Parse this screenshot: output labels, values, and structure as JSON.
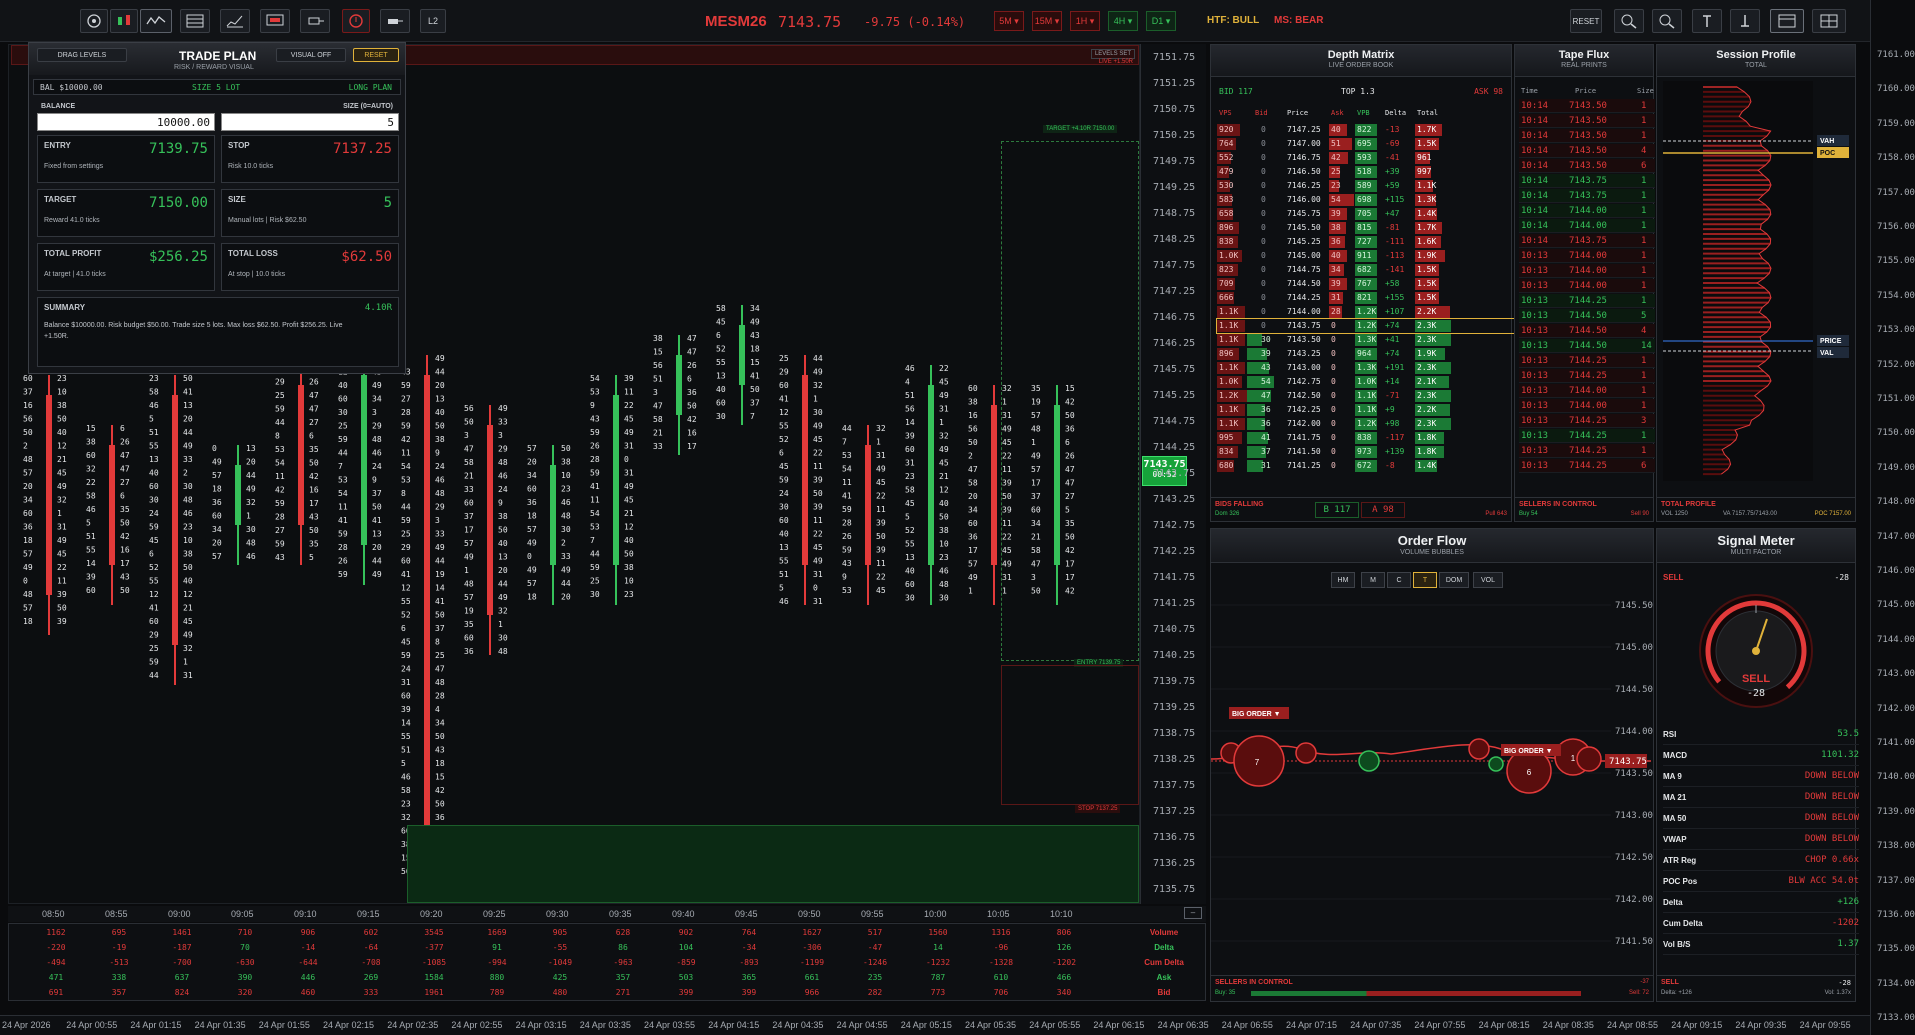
{
  "toolbar": {
    "symbol": "MESM26",
    "price": "7143.75",
    "change": "-9.75 (-0.14%)",
    "l2_label": "L2",
    "timeframes": [
      {
        "label": "5M",
        "state": "red"
      },
      {
        "label": "15M",
        "state": "red"
      },
      {
        "label": "1H",
        "state": "red"
      },
      {
        "label": "4H",
        "state": "green"
      },
      {
        "label": "D1",
        "state": "green"
      }
    ],
    "htf": "HTF: BULL",
    "ms": "MS: BEAR",
    "reset_label": "RESET",
    "tool_icons": [
      "target-icon",
      "candles-icon",
      "wave-icon",
      "table-icon",
      "line-chart-icon",
      "monitor-icon",
      "level-icon",
      "alert-icon",
      "marker-icon"
    ],
    "right_icons": [
      "zoom-in-icon",
      "zoom-out-icon",
      "line-up-icon",
      "line-down-icon",
      "layout-icon",
      "grid-icon"
    ]
  },
  "trade_plan": {
    "drag_levels": "DRAG LEVELS",
    "title": "TRADE PLAN",
    "subtitle": "RISK / REWARD VISUAL",
    "visual_off": "VISUAL OFF",
    "reset": "RESET",
    "bal": "BAL $10000.00",
    "size_lot": "SIZE 5 LOT",
    "long_plan": "LONG PLAN",
    "balance_label": "BALANCE",
    "balance_value": "10000.00",
    "size_label": "SIZE (0=AUTO)",
    "size_value": "5",
    "entry_label": "ENTRY",
    "entry_value": "7139.75",
    "entry_sub": "Fixed from settings",
    "stop_label": "STOP",
    "stop_value": "7137.25",
    "stop_sub": "Risk 10.0 ticks",
    "target_label": "TARGET",
    "target_value": "7150.00",
    "target_sub": "Reward 41.0 ticks",
    "size_box_label": "SIZE",
    "size_box_value": "5",
    "size_box_sub": "Manual lots | Risk $62.50",
    "profit_label": "TOTAL PROFIT",
    "profit_value": "$256.25",
    "profit_sub": "At target | 41.0 ticks",
    "loss_label": "TOTAL LOSS",
    "loss_value": "$62.50",
    "loss_sub": "At stop | 10.0 ticks",
    "summary_label": "SUMMARY",
    "summary_r": "4.10R",
    "summary_text": "Balance $10000.00. Risk budget $50.00. Trade size 5 lots. Max loss $62.50. Profit $256.25. Live +1.50R."
  },
  "chart_overlay": {
    "levels_set": "LEVELS SET",
    "live": "LIVE +1.50R",
    "target_tag": "TARGET +4.10R  7150.00",
    "entry_tag": "ENTRY  7139.75",
    "stop_tag": "STOP  7137.25",
    "current_price": "7143.75",
    "countdown": "00:52"
  },
  "price_axis": [
    "7151.75",
    "7151.25",
    "7150.75",
    "7150.25",
    "7149.75",
    "7149.25",
    "7148.75",
    "7148.25",
    "7147.75",
    "7147.25",
    "7146.75",
    "7146.25",
    "7145.75",
    "7145.25",
    "7144.75",
    "7144.25",
    "7143.75",
    "7143.25",
    "7142.75",
    "7142.25",
    "7141.75",
    "7141.25",
    "7140.75",
    "7140.25",
    "7139.75",
    "7139.25",
    "7138.75",
    "7138.25",
    "7137.75",
    "7137.25",
    "7136.75",
    "7136.25",
    "7135.75"
  ],
  "time_axis": [
    "08:50",
    "08:55",
    "09:00",
    "09:05",
    "09:10",
    "09:15",
    "09:20",
    "09:25",
    "09:30",
    "09:35",
    "09:40",
    "09:45",
    "09:50",
    "09:55",
    "10:00",
    "10:05",
    "10:10"
  ],
  "bottom_table": {
    "labels": [
      "Volume",
      "Delta",
      "Cum Delta",
      "Ask",
      "Bid"
    ],
    "rows": [
      [
        "1162",
        "695",
        "1461",
        "710",
        "906",
        "602",
        "3545",
        "1669",
        "905",
        "628",
        "902",
        "764",
        "1627",
        "517",
        "1560",
        "1316",
        "806"
      ],
      [
        "-220",
        "-19",
        "-187",
        "70",
        "-14",
        "-64",
        "-377",
        "91",
        "-55",
        "86",
        "104",
        "-34",
        "-306",
        "-47",
        "14",
        "-96",
        "126"
      ],
      [
        "-494",
        "-513",
        "-700",
        "-630",
        "-644",
        "-708",
        "-1085",
        "-994",
        "-1049",
        "-963",
        "-859",
        "-893",
        "-1199",
        "-1246",
        "-1232",
        "-1328",
        "-1202"
      ],
      [
        "471",
        "338",
        "637",
        "390",
        "446",
        "269",
        "1584",
        "880",
        "425",
        "357",
        "503",
        "365",
        "661",
        "235",
        "787",
        "610",
        "466"
      ],
      [
        "691",
        "357",
        "824",
        "320",
        "460",
        "333",
        "1961",
        "789",
        "480",
        "271",
        "399",
        "399",
        "966",
        "282",
        "773",
        "706",
        "340"
      ]
    ]
  },
  "date_axis": [
    "24 Apr 2026",
    "24 Apr 00:55",
    "24 Apr 01:15",
    "24 Apr 01:35",
    "24 Apr 01:55",
    "24 Apr 02:15",
    "24 Apr 02:35",
    "24 Apr 02:55",
    "24 Apr 03:15",
    "24 Apr 03:35",
    "24 Apr 03:55",
    "24 Apr 04:15",
    "24 Apr 04:35",
    "24 Apr 04:55",
    "24 Apr 05:15",
    "24 Apr 05:35",
    "24 Apr 05:55",
    "24 Apr 06:15",
    "24 Apr 06:35",
    "24 Apr 06:55",
    "24 Apr 07:15",
    "24 Apr 07:35",
    "24 Apr 07:55",
    "24 Apr 08:15",
    "24 Apr 08:35",
    "24 Apr 08:55",
    "24 Apr 09:15",
    "24 Apr 09:35",
    "24 Apr 09:55"
  ],
  "right_axis": [
    "7161.00",
    "7160.00",
    "7159.00",
    "7158.00",
    "7157.00",
    "7156.00",
    "7155.00",
    "7154.00",
    "7153.00",
    "7152.00",
    "7151.00",
    "7150.00",
    "7149.00",
    "7148.00",
    "7147.00",
    "7146.00",
    "7145.00",
    "7144.00",
    "7143.00",
    "7142.00",
    "7141.00",
    "7140.00",
    "7139.00",
    "7138.00",
    "7137.00",
    "7136.00",
    "7135.00",
    "7134.00",
    "7133.00"
  ],
  "depth_matrix": {
    "title": "Depth Matrix",
    "subtitle": "LIVE ORDER BOOK",
    "bid": "BID 117",
    "top": "TOP 1.3",
    "ask": "ASK 98",
    "headers": [
      "VPS",
      "Bid",
      "Price",
      "Ask",
      "VPB",
      "Delta",
      "Total"
    ],
    "rows": [
      [
        "920",
        "0",
        "7147.25",
        "40",
        "822",
        "-13",
        "1.7K"
      ],
      [
        "764",
        "0",
        "7147.00",
        "51",
        "695",
        "-69",
        "1.5K"
      ],
      [
        "552",
        "0",
        "7146.75",
        "42",
        "593",
        "-41",
        "961"
      ],
      [
        "479",
        "0",
        "7146.50",
        "25",
        "518",
        "+39",
        "997"
      ],
      [
        "530",
        "0",
        "7146.25",
        "23",
        "589",
        "+59",
        "1.1K"
      ],
      [
        "583",
        "0",
        "7146.00",
        "54",
        "698",
        "+115",
        "1.3K"
      ],
      [
        "658",
        "0",
        "7145.75",
        "39",
        "705",
        "+47",
        "1.4K"
      ],
      [
        "896",
        "0",
        "7145.50",
        "38",
        "815",
        "-81",
        "1.7K"
      ],
      [
        "838",
        "0",
        "7145.25",
        "36",
        "727",
        "-111",
        "1.6K"
      ],
      [
        "1.0K",
        "0",
        "7145.00",
        "40",
        "911",
        "-113",
        "1.9K"
      ],
      [
        "823",
        "0",
        "7144.75",
        "34",
        "682",
        "-141",
        "1.5K"
      ],
      [
        "709",
        "0",
        "7144.50",
        "39",
        "767",
        "+58",
        "1.5K"
      ],
      [
        "666",
        "0",
        "7144.25",
        "31",
        "821",
        "+155",
        "1.5K"
      ],
      [
        "1.1K",
        "0",
        "7144.00",
        "28",
        "1.2K",
        "+107",
        "2.2K"
      ],
      [
        "1.1K",
        "0",
        "7143.75",
        "0",
        "1.2K",
        "+74",
        "2.3K"
      ],
      [
        "1.1K",
        "30",
        "7143.50",
        "0",
        "1.3K",
        "+41",
        "2.3K"
      ],
      [
        "896",
        "39",
        "7143.25",
        "0",
        "964",
        "+74",
        "1.9K"
      ],
      [
        "1.1K",
        "43",
        "7143.00",
        "0",
        "1.3K",
        "+191",
        "2.3K"
      ],
      [
        "1.0K",
        "54",
        "7142.75",
        "0",
        "1.0K",
        "+14",
        "2.1K"
      ],
      [
        "1.2K",
        "47",
        "7142.50",
        "0",
        "1.1K",
        "-71",
        "2.3K"
      ],
      [
        "1.1K",
        "36",
        "7142.25",
        "0",
        "1.1K",
        "+9",
        "2.2K"
      ],
      [
        "1.1K",
        "36",
        "7142.00",
        "0",
        "1.2K",
        "+98",
        "2.3K"
      ],
      [
        "995",
        "41",
        "7141.75",
        "0",
        "838",
        "-117",
        "1.8K"
      ],
      [
        "834",
        "37",
        "7141.50",
        "0",
        "973",
        "+139",
        "1.8K"
      ],
      [
        "680",
        "31",
        "7141.25",
        "0",
        "672",
        "-8",
        "1.4K"
      ]
    ],
    "footer_left": "BIDS FALLING",
    "footer_b": "B 117",
    "footer_a": "A 98",
    "footer_sub": "Dom 326",
    "footer_right": "Pull 643"
  },
  "tape_flux": {
    "title": "Tape Flux",
    "subtitle": "REAL PRINTS",
    "headers": [
      "Time",
      "Price",
      "Size"
    ],
    "rows": [
      [
        "10:14",
        "7143.50",
        "1",
        "red"
      ],
      [
        "10:14",
        "7143.50",
        "1",
        "red"
      ],
      [
        "10:14",
        "7143.50",
        "1",
        "red"
      ],
      [
        "10:14",
        "7143.50",
        "4",
        "red"
      ],
      [
        "10:14",
        "7143.50",
        "6",
        "red"
      ],
      [
        "10:14",
        "7143.75",
        "1",
        "green"
      ],
      [
        "10:14",
        "7143.75",
        "1",
        "green"
      ],
      [
        "10:14",
        "7144.00",
        "1",
        "green"
      ],
      [
        "10:14",
        "7144.00",
        "1",
        "green"
      ],
      [
        "10:14",
        "7143.75",
        "1",
        "red"
      ],
      [
        "10:13",
        "7144.00",
        "1",
        "red"
      ],
      [
        "10:13",
        "7144.00",
        "1",
        "red"
      ],
      [
        "10:13",
        "7144.00",
        "1",
        "red"
      ],
      [
        "10:13",
        "7144.25",
        "1",
        "green"
      ],
      [
        "10:13",
        "7144.50",
        "5",
        "green"
      ],
      [
        "10:13",
        "7144.50",
        "4",
        "red"
      ],
      [
        "10:13",
        "7144.50",
        "14",
        "green"
      ],
      [
        "10:13",
        "7144.25",
        "1",
        "red"
      ],
      [
        "10:13",
        "7144.25",
        "1",
        "red"
      ],
      [
        "10:13",
        "7144.00",
        "1",
        "red"
      ],
      [
        "10:13",
        "7144.00",
        "1",
        "red"
      ],
      [
        "10:13",
        "7144.25",
        "3",
        "red"
      ],
      [
        "10:13",
        "7144.25",
        "1",
        "green"
      ],
      [
        "10:13",
        "7144.25",
        "1",
        "red"
      ],
      [
        "10:13",
        "7144.25",
        "6",
        "red"
      ]
    ],
    "footer": "SELLERS IN CONTROL",
    "footer_sub_left": "Buy 54",
    "footer_sub_right": "Sell 90"
  },
  "session_profile": {
    "title": "Session Profile",
    "subtitle": "TOTAL",
    "vah": "VAH",
    "poc": "POC",
    "price": "PRICE",
    "val": "VAL",
    "footer": "TOTAL PROFILE",
    "footer_sub_left": "VOL 1250",
    "footer_sub_mid": "VA 7157.75/7143.00",
    "footer_sub_right": "POC 7157.00"
  },
  "order_flow": {
    "title": "Order Flow",
    "subtitle": "VOLUME BUBBLES",
    "buttons": [
      "HM",
      "M",
      "C",
      "T",
      "DOM",
      "VOL"
    ],
    "active": "T",
    "axis": [
      "7145.50",
      "7145.00",
      "7144.50",
      "7144.00",
      "7143.50",
      "7143.00",
      "7142.50",
      "7142.00",
      "7141.50"
    ],
    "big_order": "BIG ORDER",
    "current": "7143.75",
    "bubble_labels": [
      "7",
      "6",
      "1"
    ],
    "footer": "SELLERS IN CONTROL",
    "footer_sub_left": "Buy: 35",
    "footer_sub_right": "Sell: 72",
    "footer_count": "-37"
  },
  "signal_meter": {
    "title": "Signal Meter",
    "subtitle": "MULTI FACTOR",
    "state": "SELL",
    "score": "-28",
    "gauge_state": "SELL",
    "gauge_score": "-28",
    "rows": [
      {
        "k": "RSI",
        "v": "53.5",
        "c": "green"
      },
      {
        "k": "MACD",
        "v": "1101.32",
        "c": "green"
      },
      {
        "k": "MA 9",
        "v": "DOWN BELOW",
        "c": "red"
      },
      {
        "k": "MA 21",
        "v": "DOWN BELOW",
        "c": "red"
      },
      {
        "k": "MA 50",
        "v": "DOWN BELOW",
        "c": "red"
      },
      {
        "k": "VWAP",
        "v": "DOWN BELOW",
        "c": "red"
      },
      {
        "k": "ATR Reg",
        "v": "CHOP 0.66x",
        "c": "red"
      },
      {
        "k": "POC Pos",
        "v": "BLW ACC 54.0t",
        "c": "red"
      },
      {
        "k": "Delta",
        "v": "+126",
        "c": "green"
      },
      {
        "k": "Cum Delta",
        "v": "-1202",
        "c": "red"
      },
      {
        "k": "Vol B/S",
        "v": "1.37",
        "c": "green"
      }
    ],
    "footer": "SELL",
    "footer_score": "-28",
    "footer_sub_left": "Delta: +126",
    "footer_sub_right": "Vol: 1.37x"
  },
  "colors": {
    "bull": "#36c15a",
    "bear": "#e23a3a",
    "accent": "#e0b23a",
    "bg": "#0a0b0d"
  }
}
